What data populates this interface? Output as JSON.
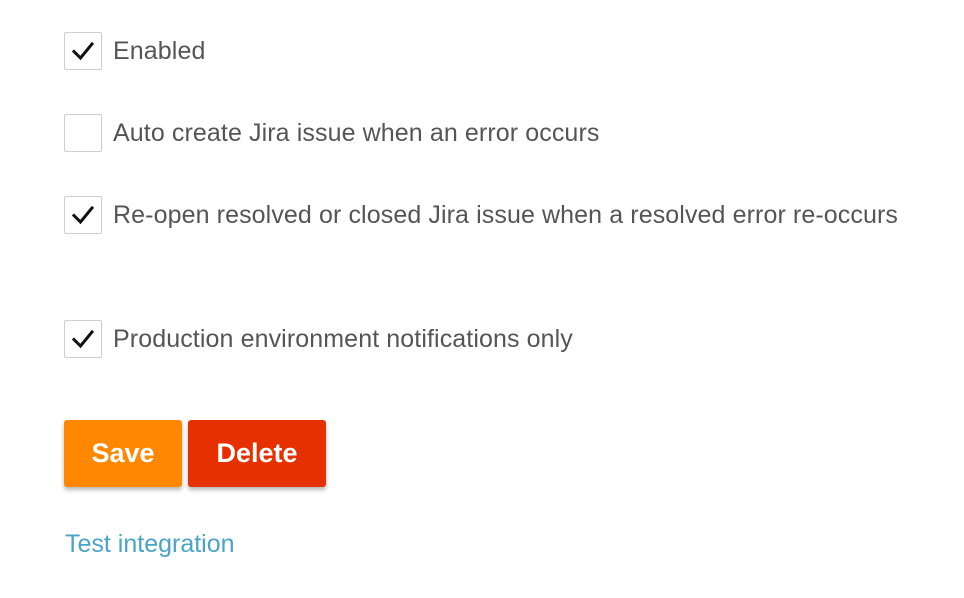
{
  "options": [
    {
      "label": "Enabled",
      "checked": true
    },
    {
      "label": "Auto create Jira issue when an error occurs",
      "checked": false
    },
    {
      "label": "Re-open resolved or closed Jira issue when a resolved error re-occurs",
      "checked": true
    },
    {
      "label": "Production environment notifications only",
      "checked": true
    }
  ],
  "actions": {
    "save_label": "Save",
    "delete_label": "Delete",
    "save_color": "#ff8800",
    "delete_color": "#e63000"
  },
  "links": {
    "test_integration_label": "Test integration",
    "link_color": "#4aa3c8"
  },
  "icons": {
    "checkmark": "check-icon"
  }
}
